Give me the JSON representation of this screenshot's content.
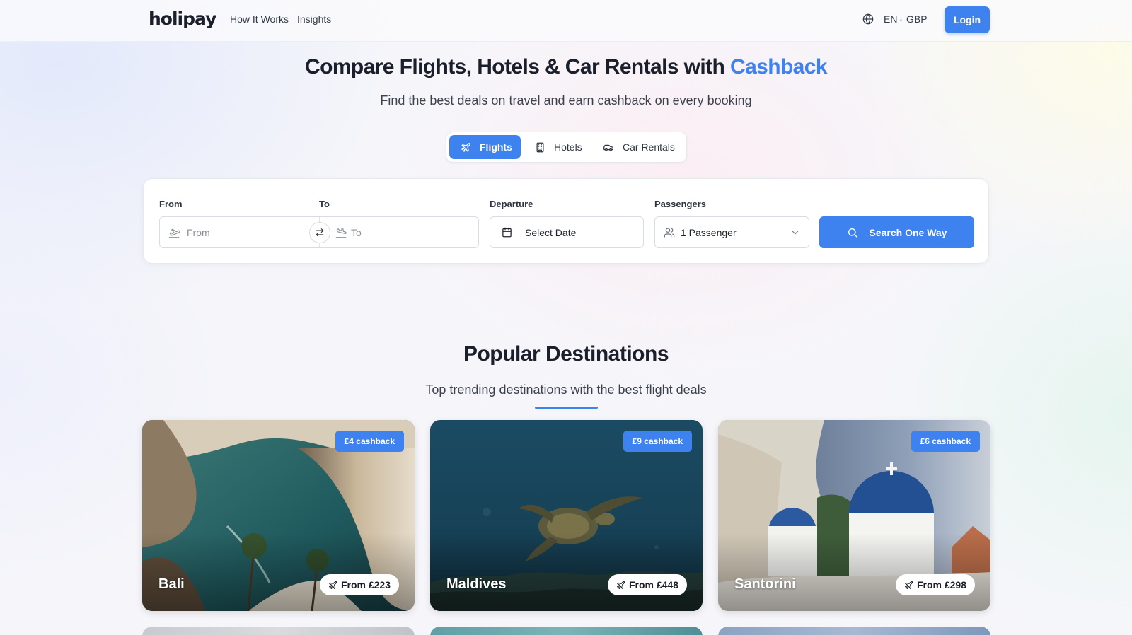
{
  "header": {
    "logo": "holipay",
    "nav": [
      {
        "label": "How It Works"
      },
      {
        "label": "Insights"
      }
    ],
    "language": "EN",
    "currency": "GBP",
    "login_label": "Login"
  },
  "hero": {
    "title_main": "Compare Flights, Hotels & Car Rentals with ",
    "title_accent": "Cashback",
    "subtitle": "Find the best deals on travel and earn cashback on every booking"
  },
  "tabs": {
    "flights": "Flights",
    "hotels": "Hotels",
    "car_rentals": "Car Rentals",
    "active": "Flights"
  },
  "search": {
    "from_label": "From",
    "from_placeholder": "From",
    "to_label": "To",
    "to_placeholder": "To",
    "departure_label": "Departure",
    "departure_value": "Select Date",
    "passengers_label": "Passengers",
    "passengers_value": "1 Passenger",
    "submit_label": "Search One Way"
  },
  "popular": {
    "title": "Popular Destinations",
    "subtitle": "Top trending destinations with the best flight deals",
    "destinations": [
      {
        "name": "Bali",
        "cashback": "£4 cashback",
        "price": "From £223"
      },
      {
        "name": "Maldives",
        "cashback": "£9 cashback",
        "price": "From £448"
      },
      {
        "name": "Santorini",
        "cashback": "£6 cashback",
        "price": "From £298"
      }
    ]
  },
  "colors": {
    "accent": "#3d82ee",
    "text": "#1b1f2b",
    "muted": "#8b909b"
  },
  "icons": {
    "globe": "globe-icon",
    "plane": "plane-icon",
    "hotel": "building-icon",
    "car": "car-icon",
    "takeoff": "plane-takeoff-icon",
    "landing": "plane-landing-icon",
    "swap": "swap-arrows-icon",
    "calendar": "calendar-icon",
    "users": "users-icon",
    "chevron": "chevron-down-icon",
    "search": "search-icon"
  }
}
